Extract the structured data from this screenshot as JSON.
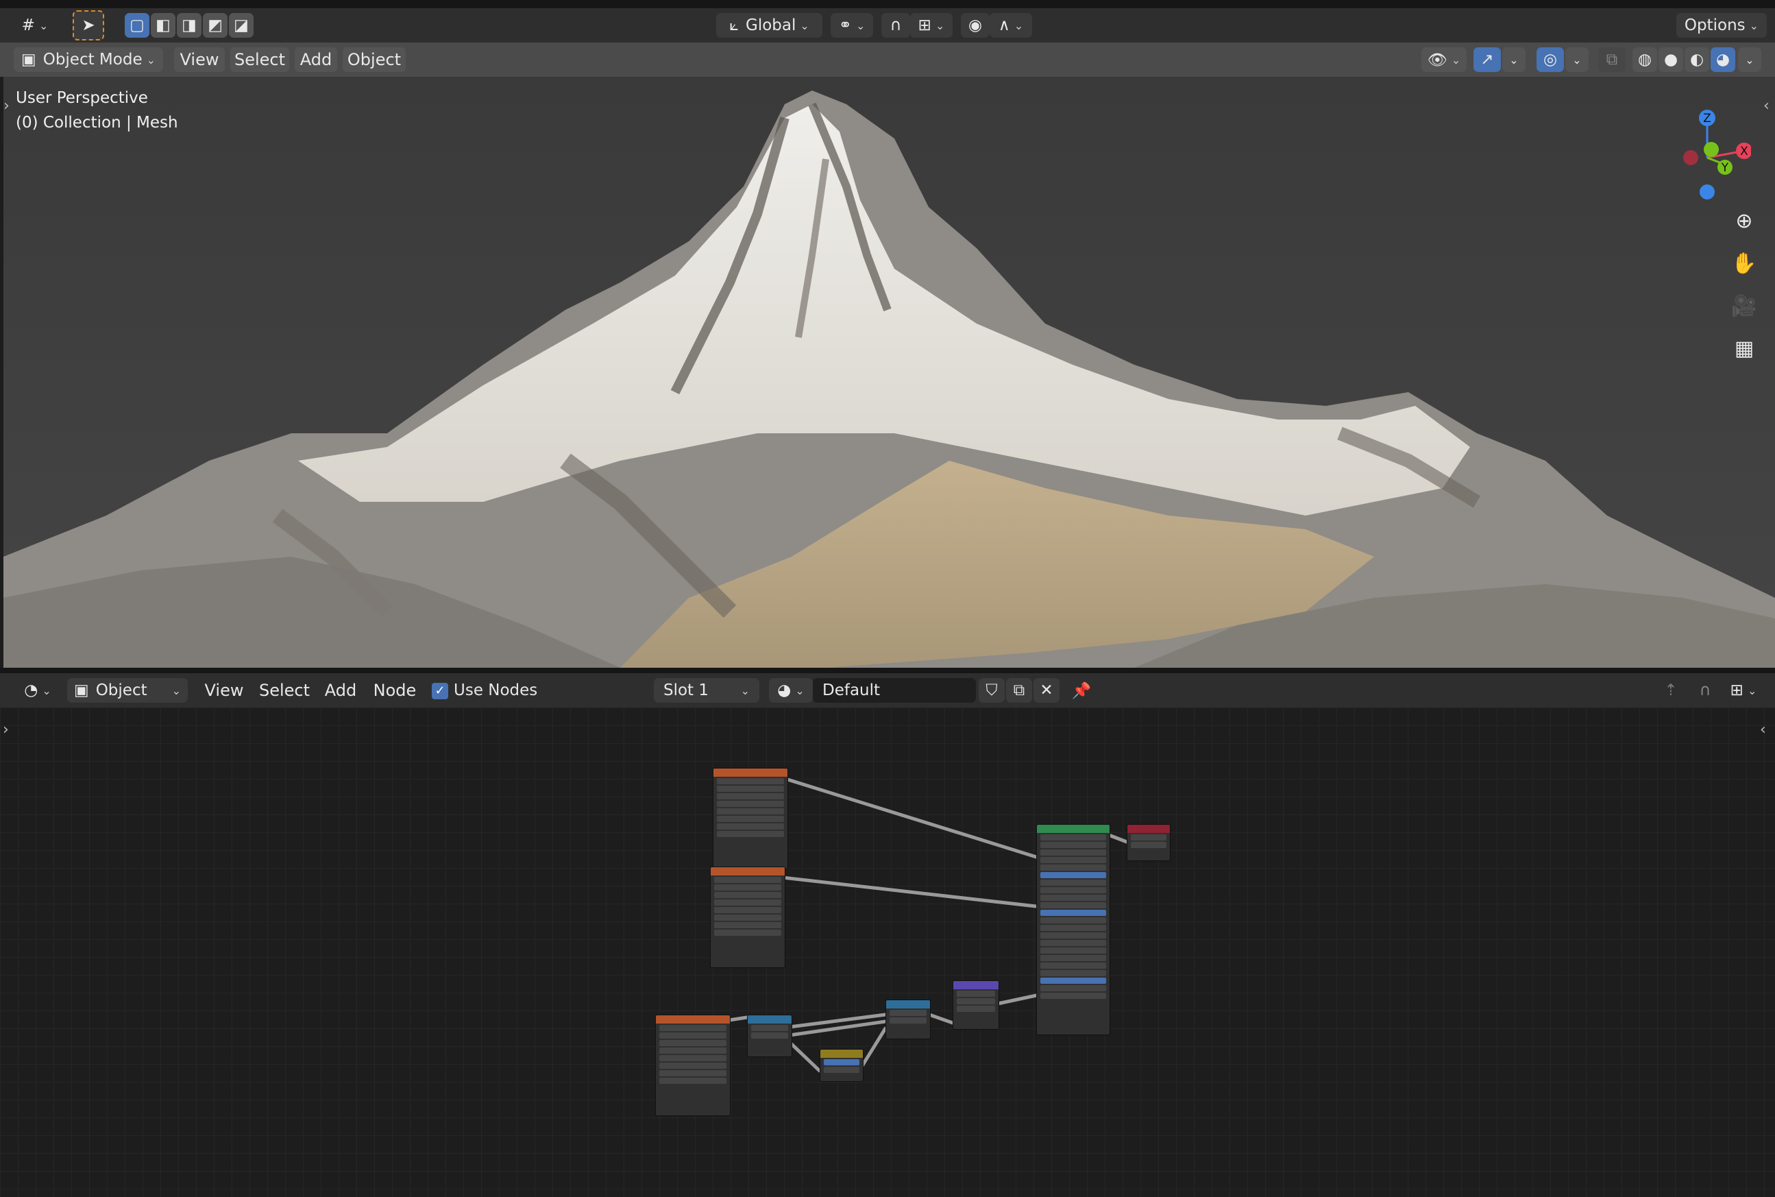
{
  "viewport_header": {
    "mode_label": "Object Mode",
    "menus": [
      "View",
      "Select",
      "Add",
      "Object"
    ],
    "transform_orientation": "Global",
    "options_label": "Options"
  },
  "viewport": {
    "overlay_line1": "User Perspective",
    "overlay_line2": "(0) Collection | Mesh",
    "gizmo": {
      "z_label": "Z",
      "y_label": "Y",
      "x_label": "X"
    }
  },
  "node_header": {
    "object_label": "Object",
    "menus": [
      "View",
      "Select",
      "Add",
      "Node"
    ],
    "use_nodes_label": "Use Nodes",
    "use_nodes_checked": true,
    "slot_label": "Slot 1",
    "material_name": "Default"
  },
  "colors": {
    "accent_blue": "#4772b3",
    "texture_node_header": "#b5542b",
    "principled_node_header": "#2f8b50",
    "output_node_header": "#8f2233",
    "vector_node_header": "#5a48b0",
    "converter_node_header": "#2d6f9a",
    "color_node_header": "#8f7c1f",
    "axis_x": "#e8415a",
    "axis_y": "#77c21a",
    "axis_z": "#3a86e8"
  }
}
